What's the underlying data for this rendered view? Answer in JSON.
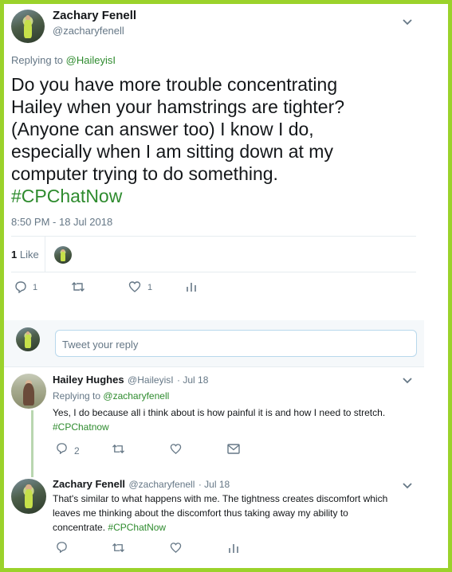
{
  "main_tweet": {
    "author_name": "Zachary Fenell",
    "author_handle": "@zacharyfenell",
    "replying_prefix": "Replying to",
    "replying_to": "@HaileyisI",
    "text_lines": [
      "Do you have more trouble concentrating",
      "Hailey when your hamstrings are tighter?",
      "(Anyone can answer too) I know I do,",
      "especially when I am sitting down at my",
      "computer trying to do something."
    ],
    "hashtag": "#CPChatNow",
    "timestamp": "8:50 PM - 18 Jul 2018",
    "likes_count": "1",
    "likes_label": "Like",
    "reply_count": "1",
    "like_count": "1"
  },
  "reply_composer": {
    "placeholder": "Tweet your reply"
  },
  "replies": [
    {
      "author_name": "Hailey Hughes",
      "author_handle": "@HaileyisI",
      "date": "· Jul 18",
      "replying_prefix": "Replying to",
      "replying_to": "@zacharyfenell",
      "text": "Yes, I do because all i think about is how painful it is and how I need to stretch.",
      "hashtag": "#CPChatnow",
      "reply_count": "2"
    },
    {
      "author_name": "Zachary Fenell",
      "author_handle": "@zacharyfenell",
      "date": "· Jul 18",
      "text_lines": [
        "That's similar to what happens with me. The tightness creates discomfort which",
        "leaves me thinking about the discomfort thus taking away my ability to"
      ],
      "text_last": "concentrate.",
      "hashtag": "#CPChatNow"
    }
  ],
  "colors": {
    "frame": "#9bd22b",
    "hashtag": "#2e8b2e",
    "muted": "#657786"
  },
  "icons": [
    "reply-icon",
    "retweet-icon",
    "heart-icon",
    "analytics-icon",
    "mail-icon",
    "chevron-down-icon"
  ]
}
